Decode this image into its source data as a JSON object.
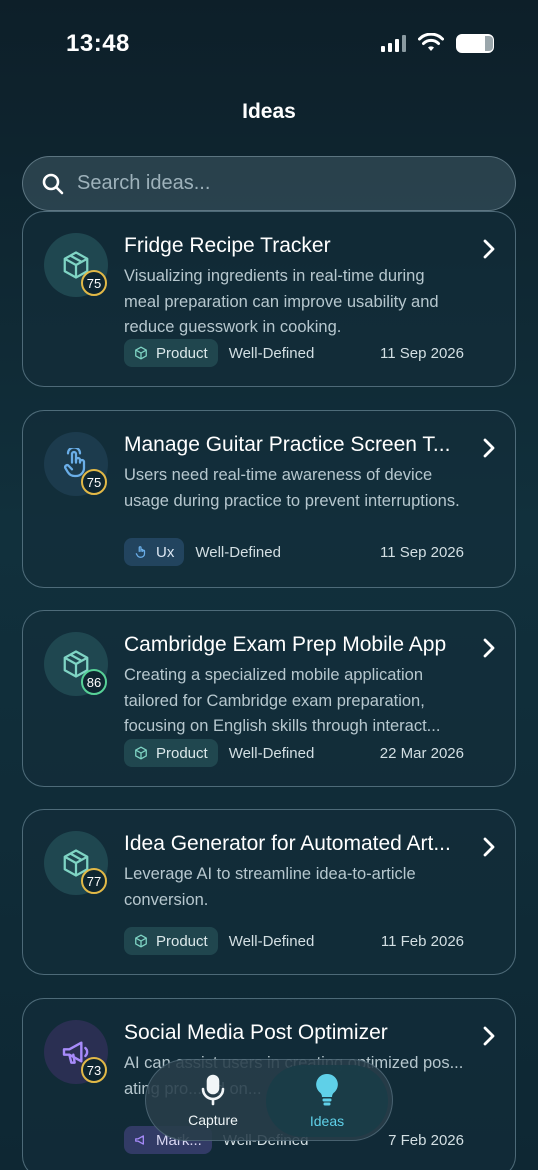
{
  "status_bar": {
    "time": "13:48"
  },
  "header": {
    "title": "Ideas"
  },
  "search": {
    "placeholder": "Search ideas..."
  },
  "cards": [
    {
      "title": "Fridge Recipe Tracker",
      "description": "Visualizing ingredients in real-time during meal preparation can improve usability and reduce guesswork in cooking.",
      "score": "75",
      "category": "Product",
      "status": "Well-Defined",
      "date": "11 Sep 2026",
      "icon": "cube-icon"
    },
    {
      "title": "Manage Guitar Practice Screen T...",
      "description": "Users need real-time awareness of device usage during practice to prevent interruptions.",
      "score": "75",
      "category": "Ux",
      "status": "Well-Defined",
      "date": "11 Sep 2026",
      "icon": "tap-hand-icon"
    },
    {
      "title": "Cambridge Exam Prep Mobile App",
      "description": "Creating a specialized mobile application tailored for Cambridge exam preparation, focusing on English skills through interact...",
      "score": "86",
      "category": "Product",
      "status": "Well-Defined",
      "date": "22 Mar 2026",
      "icon": "cube-icon"
    },
    {
      "title": "Idea Generator for Automated Art...",
      "description": "Leverage AI to streamline idea-to-article conversion.",
      "score": "77",
      "category": "Product",
      "status": "Well-Defined",
      "date": "11 Feb 2026",
      "icon": "cube-icon"
    },
    {
      "title": "Social Media Post Optimizer",
      "description": "AI can assist users in creating optimized pos... ating pro... ed on...",
      "score": "73",
      "category": "Mark...",
      "status": "Well-Defined",
      "date": "7 Feb 2026",
      "icon": "megaphone-icon"
    }
  ],
  "bottom_nav": {
    "capture_label": "Capture",
    "ideas_label": "Ideas",
    "active": "Ideas"
  },
  "colors": {
    "accent": "#5fd0e8",
    "score_yellow": "#e2b947",
    "score_green": "#57d197",
    "product_icon": "#7fd4c4",
    "ux_icon": "#6aaee8",
    "marketing_icon": "#a78bfa"
  }
}
